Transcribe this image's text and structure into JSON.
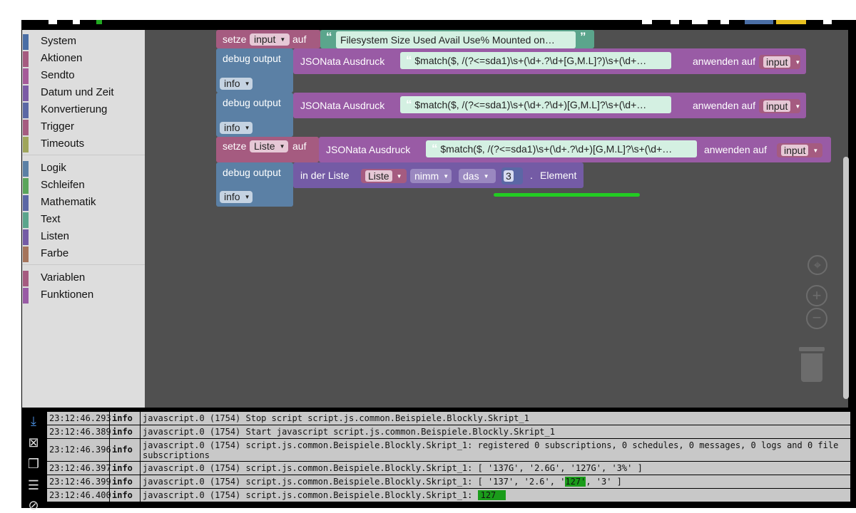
{
  "toolbox": {
    "categories": [
      {
        "label": "System",
        "color": "#4a6ea5"
      },
      {
        "label": "Aktionen",
        "color": "#a55b80"
      },
      {
        "label": "Sendto",
        "color": "#a55b99"
      },
      {
        "label": "Datum und Zeit",
        "color": "#7b5ba5"
      },
      {
        "label": "Konvertierung",
        "color": "#5b68a5"
      },
      {
        "label": "Trigger",
        "color": "#a55b80"
      },
      {
        "label": "Timeouts",
        "color": "#9fa55b"
      },
      {
        "label": "Logik",
        "color": "#5b80a5"
      },
      {
        "label": "Schleifen",
        "color": "#5ba55b"
      },
      {
        "label": "Mathematik",
        "color": "#5b67a5"
      },
      {
        "label": "Text",
        "color": "#5ba58c"
      },
      {
        "label": "Listen",
        "color": "#745ba5"
      },
      {
        "label": "Farbe",
        "color": "#a5745b"
      },
      {
        "label": "Variablen",
        "color": "#a55b80"
      },
      {
        "label": "Funktionen",
        "color": "#995ba5"
      }
    ]
  },
  "blocks": {
    "setze": "setze",
    "auf": "auf",
    "var_input": "input",
    "var_liste": "Liste",
    "filesystem_text": "Filesystem      Size  Used Avail Use% Mounted on…",
    "debug_output": "debug output",
    "info": "info",
    "jsonata": "JSONata Ausdruck",
    "regex1": "$match($, /(?<=sda1)\\s+(\\d+.?\\d+[G,M.L]?)\\s+(\\d+…",
    "regex2": "$match($, /(?<=sda1)\\s+(\\d+.?\\d+)[G,M.L]?\\s+(\\d+…",
    "regex3": "$match($, /(?<=sda1)\\s+(\\d+.?\\d+)[G,M.L]?\\s+(\\d+…",
    "anwenden_auf": "anwenden auf",
    "in_der_liste": "in der Liste",
    "nimm": "nimm",
    "das": "das",
    "index": "3",
    "dot": ".",
    "element": "Element"
  },
  "colors": {
    "variables": "#a55b80",
    "text": "#5ba58c",
    "debug": "#5b80a5",
    "jsonata": "#995ba5",
    "lists": "#745ba5",
    "highlight": "#1a9c1a"
  },
  "log": {
    "rows": [
      {
        "time": "23:12:46.293",
        "level": "info",
        "msg": "javascript.0 (1754) Stop script script.js.common.Beispiele.Blockly.Skript_1"
      },
      {
        "time": "23:12:46.389",
        "level": "info",
        "msg": "javascript.0 (1754) Start javascript script.js.common.Beispiele.Blockly.Skript_1"
      },
      {
        "time": "23:12:46.396",
        "level": "info",
        "msg": "javascript.0 (1754) script.js.common.Beispiele.Blockly.Skript_1: registered 0 subscriptions, 0 schedules, 0 messages, 0 logs and 0 file subscriptions"
      },
      {
        "time": "23:12:46.397",
        "level": "info",
        "msg": "javascript.0 (1754) script.js.common.Beispiele.Blockly.Skript_1: [ '137G', '2.6G', '127G', '3%' ]"
      },
      {
        "time": "23:12:46.399",
        "level": "info",
        "msg_pre": "javascript.0 (1754) script.js.common.Beispiele.Blockly.Skript_1: [ '137', '2.6', '",
        "msg_hl": "127'",
        "msg_post": ", '3' ]"
      },
      {
        "time": "23:12:46.400",
        "level": "info",
        "msg_pre": "javascript.0 (1754) script.js.common.Beispiele.Blockly.Skript_1: ",
        "msg_hl": "127"
      }
    ]
  }
}
